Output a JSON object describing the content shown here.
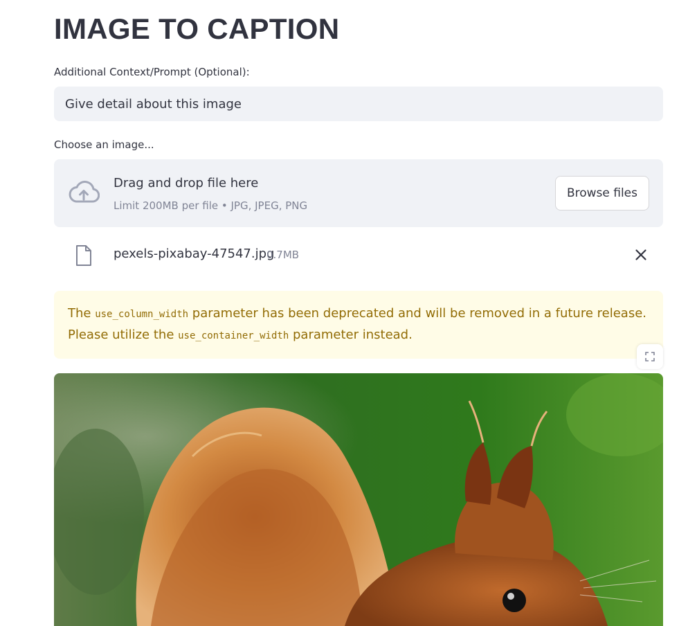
{
  "page": {
    "title": "IMAGE TO CAPTION"
  },
  "prompt": {
    "label": "Additional Context/Prompt (Optional):",
    "value": "Give detail about this image"
  },
  "uploader": {
    "label": "Choose an image...",
    "drag_text": "Drag and drop file here",
    "limit_text": "Limit 200MB per file • JPG, JPEG, PNG",
    "browse_label": "Browse files",
    "icon": "cloud-upload-icon"
  },
  "uploaded_file": {
    "name": "pexels-pixabay-47547.jpg",
    "size": "0.7MB",
    "icon": "file-icon",
    "remove_icon": "close-icon"
  },
  "warning": {
    "text_1": "The ",
    "code_1": "use_column_width",
    "text_2": " parameter has been deprecated and will be removed in a future release. Please utilize the ",
    "code_2": "use_container_width",
    "text_3": " parameter instead."
  },
  "image_view": {
    "fullscreen_icon": "fullscreen-icon",
    "subject": "red squirrel photo"
  },
  "colors": {
    "surface": "#f0f2f6",
    "text": "#31333f",
    "muted": "#808495",
    "warning_bg": "#fffce7",
    "warning_text": "#926c05"
  }
}
